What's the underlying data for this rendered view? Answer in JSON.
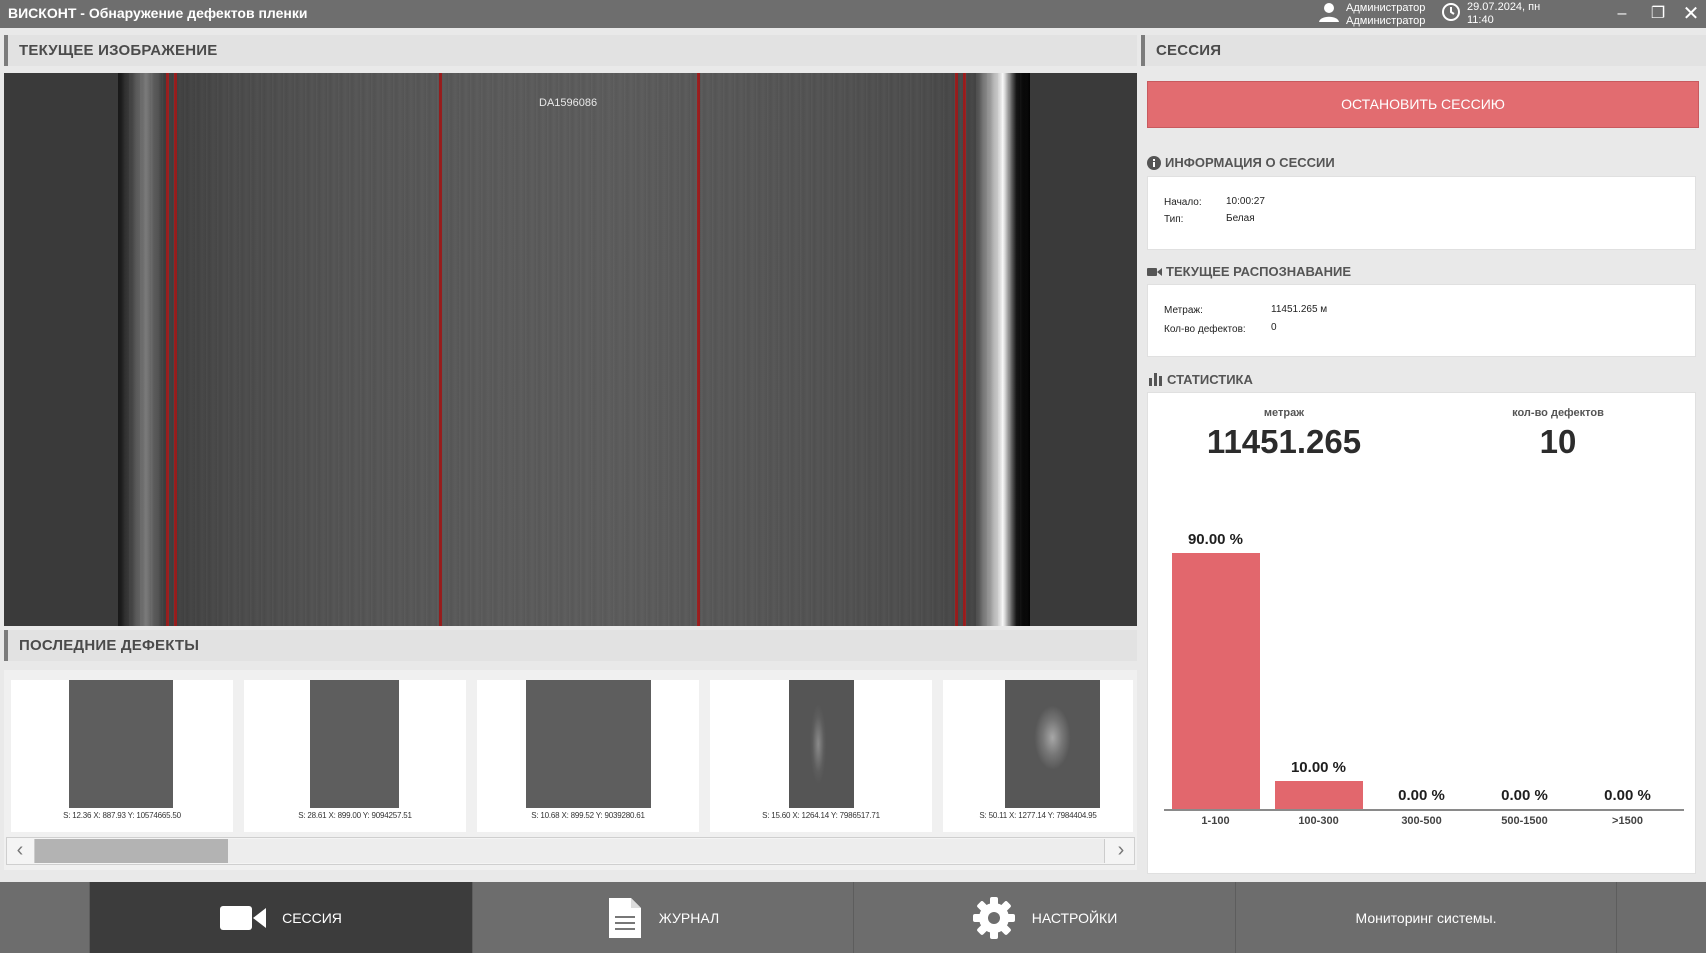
{
  "window": {
    "title": "ВИСКОНТ - Обнаружение дефектов пленки",
    "user_line1": "Администратор",
    "user_line2": "Администратор",
    "date": "29.07.2024, пн",
    "time": "11:40",
    "minimize": "–",
    "maximize": "❐",
    "close": "✕"
  },
  "current_image": {
    "header": "ТЕКУЩЕЕ ИЗОБРАЖЕНИЕ",
    "frame_id": "DA1596086"
  },
  "last_defects": {
    "header": "ПОСЛЕДНИЕ ДЕФЕКТЫ",
    "items": [
      {
        "meta": "S: 12.36     X: 887.93     Y: 10574665.50"
      },
      {
        "meta": "S: 28.61     X: 899.00     Y: 9094257.51"
      },
      {
        "meta": "S: 10.68     X: 899.52     Y: 9039280.61"
      },
      {
        "meta": "S: 15.60     X: 1264.14     Y: 7986517.71"
      },
      {
        "meta": "S: 50.11     X: 1277.14     Y: 7984404.95"
      }
    ],
    "scroll_left": "‹",
    "scroll_right": "›",
    "scroll_position": 0.18
  },
  "session": {
    "header": "СЕССИЯ",
    "stop_button": "ОСТАНОВИТЬ СЕССИЮ",
    "info": {
      "title": "ИНФОРМАЦИЯ О СЕССИИ",
      "start_label": "Начало:",
      "start_value": "10:00:27",
      "type_label": "Тип:",
      "type_value": "Белая"
    },
    "recognition": {
      "title": "ТЕКУЩЕЕ РАСПОЗНАВАНИЕ",
      "length_label": "Метраж:",
      "length_value": "11451.265 м",
      "defects_label": "Кол-во дефектов:",
      "defects_value": "0"
    },
    "stats": {
      "title": "СТАТИСТИКА",
      "length_caption": "метраж",
      "length_value": "11451.265",
      "defects_caption": "кол-во дефектов",
      "defects_value": "10"
    }
  },
  "chart_data": {
    "type": "bar",
    "categories": [
      "1-100",
      "100-300",
      "300-500",
      "500-1500",
      ">1500"
    ],
    "values": [
      90.0,
      10.0,
      0.0,
      0.0,
      0.0
    ],
    "value_labels": [
      "90.00 %",
      "10.00 %",
      "0.00 %",
      "0.00 %",
      "0.00 %"
    ],
    "ylim": [
      0,
      100
    ],
    "bar_color": "#e2676d"
  },
  "nav": {
    "session": "СЕССИЯ",
    "journal": "ЖУРНАЛ",
    "settings": "НАСТРОЙКИ",
    "monitoring": "Мониторинг системы."
  },
  "colors": {
    "accent": "#e26c70",
    "nav_active": "#3c3c3c",
    "titlebar": "#6e6e6e"
  }
}
